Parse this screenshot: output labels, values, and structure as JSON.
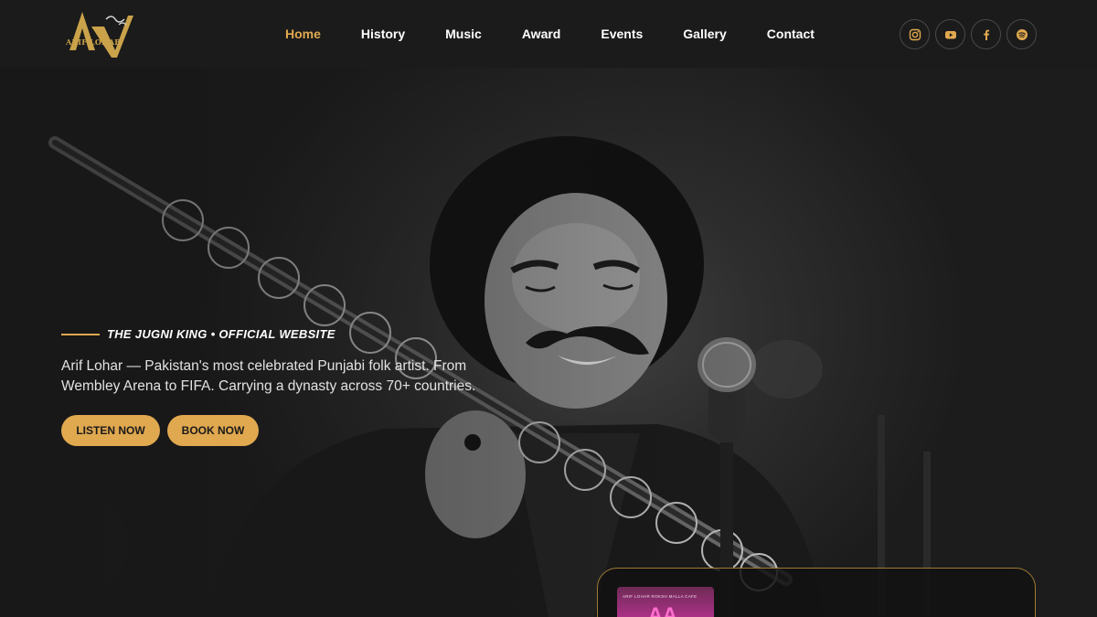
{
  "brand": {
    "logo_text": "ARIF LOHAR"
  },
  "nav": {
    "items": [
      {
        "label": "Home",
        "active": true
      },
      {
        "label": "History",
        "active": false
      },
      {
        "label": "Music",
        "active": false
      },
      {
        "label": "Award",
        "active": false
      },
      {
        "label": "Events",
        "active": false
      },
      {
        "label": "Gallery",
        "active": false
      },
      {
        "label": "Contact",
        "active": false
      }
    ]
  },
  "social": [
    {
      "icon": "instagram-icon"
    },
    {
      "icon": "youtube-icon"
    },
    {
      "icon": "facebook-icon"
    },
    {
      "icon": "spotify-icon"
    }
  ],
  "hero": {
    "eyebrow": "THE JUGNI KING • OFFICIAL WEBSITE",
    "description": "Arif Lohar — Pakistan's most celebrated Punjabi folk artist. From Wembley Arena to FIFA. Carrying a dynasty across 70+ countries.",
    "listen_label": "LISTEN NOW",
    "book_label": "BOOK NOW"
  },
  "player": {
    "album_top": "ARIF LOHAR   ROKSH MALLA   CAFE",
    "album_mark": "AA"
  },
  "colors": {
    "accent": "#e0a84f",
    "header_bg": "#1b1b1b",
    "card_border": "#a07a36"
  }
}
